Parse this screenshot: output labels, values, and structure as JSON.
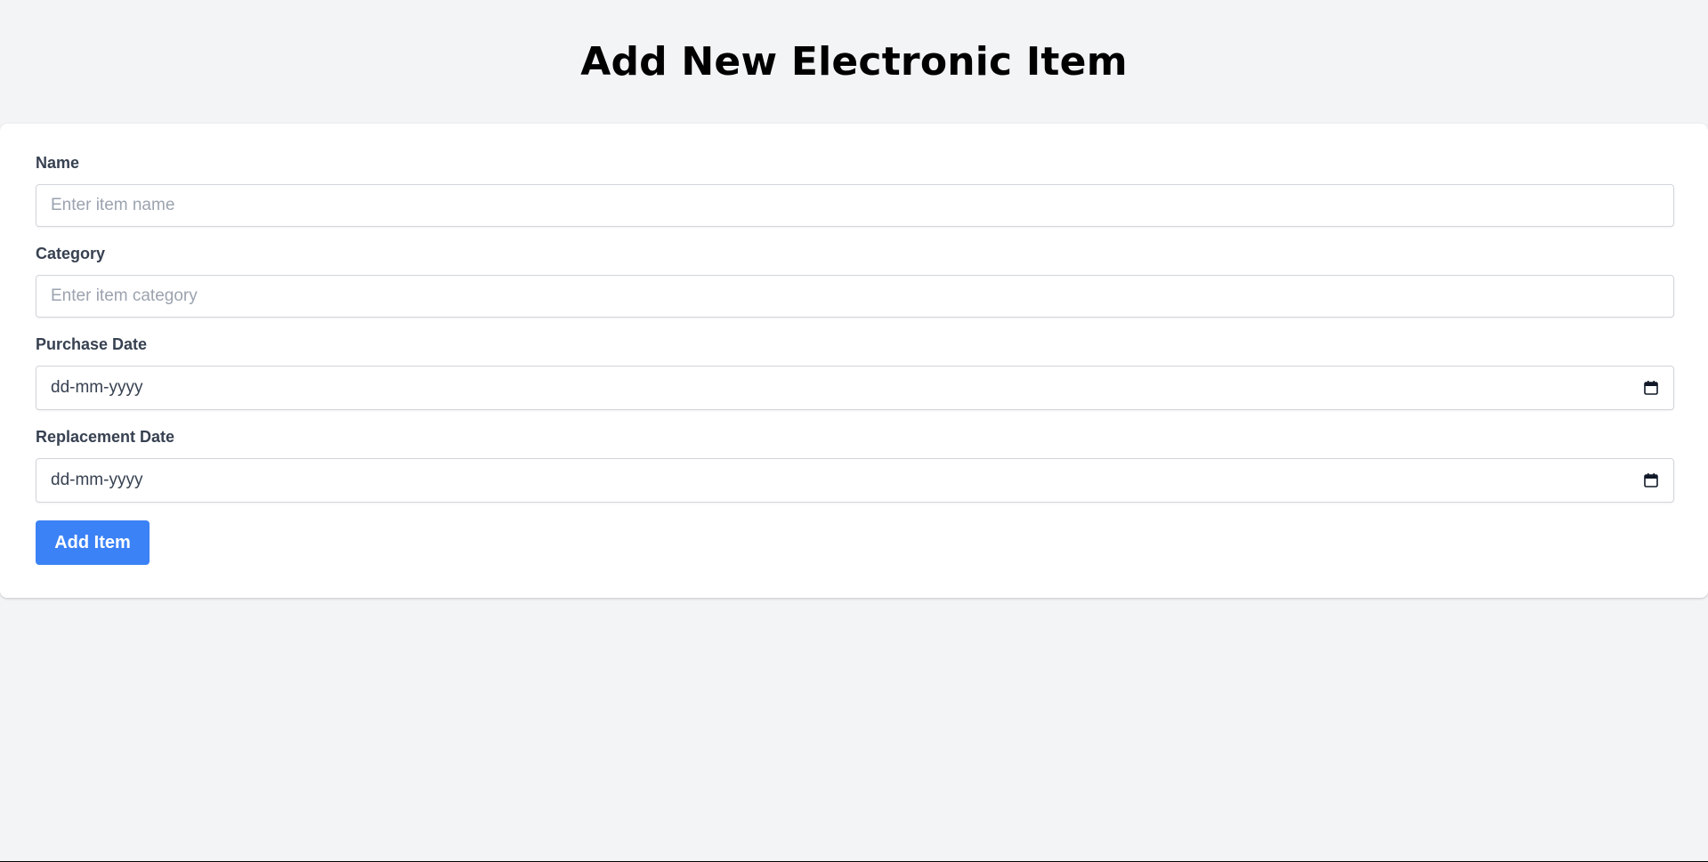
{
  "page": {
    "title": "Add New Electronic Item"
  },
  "form": {
    "name": {
      "label": "Name",
      "placeholder": "Enter item name",
      "value": ""
    },
    "category": {
      "label": "Category",
      "placeholder": "Enter item category",
      "value": ""
    },
    "purchase_date": {
      "label": "Purchase Date",
      "display": "dd-mm-yyyy",
      "icon": "calendar-icon"
    },
    "replacement_date": {
      "label": "Replacement Date",
      "display": "dd-mm-yyyy",
      "icon": "calendar-icon"
    },
    "submit_label": "Add Item"
  },
  "colors": {
    "background": "#f3f4f6",
    "card": "#ffffff",
    "accent": "#3b82f6",
    "label": "#374151",
    "placeholder": "#9ca3af"
  }
}
